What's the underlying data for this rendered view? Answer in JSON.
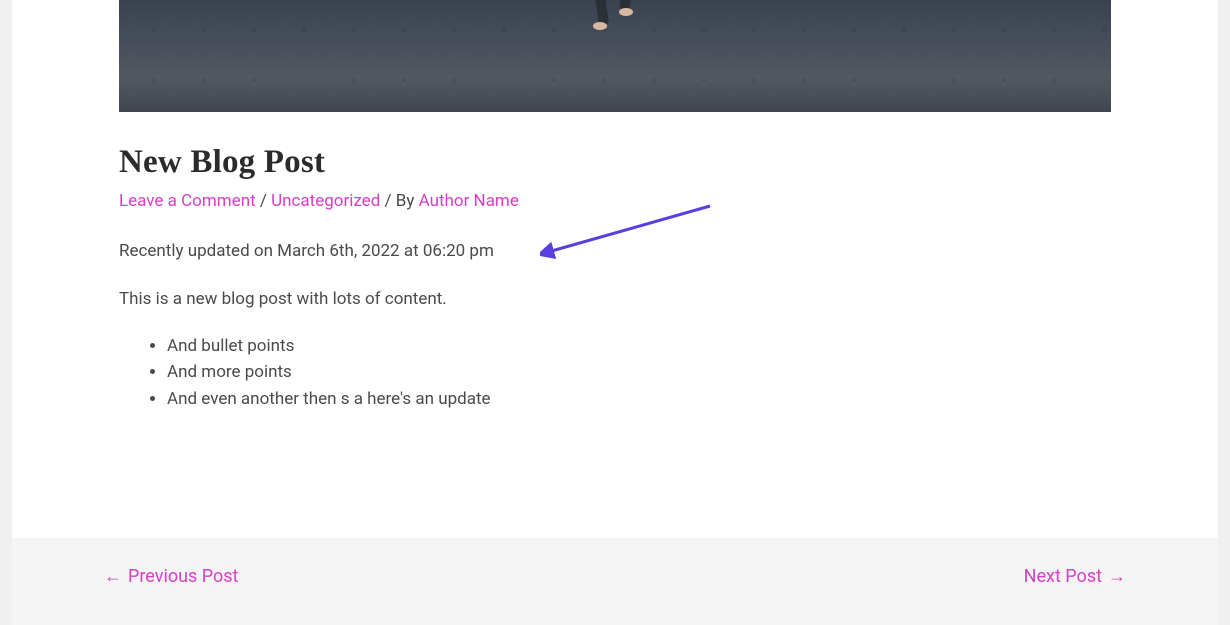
{
  "post": {
    "title": "New Blog Post",
    "meta": {
      "comment_link": "Leave a Comment",
      "sep1": " / ",
      "category": "Uncategorized",
      "by_text": " / By ",
      "author": "Author Name"
    },
    "updated_text": "Recently updated on March 6th, 2022 at 06:20 pm",
    "intro": "This is a new blog post with lots of content.",
    "bullets": [
      "And bullet points",
      "And more points",
      "And even another then s a here's an update"
    ]
  },
  "nav": {
    "prev_arrow": "←",
    "prev_label": "Previous Post",
    "next_label": "Next Post",
    "next_arrow": "→"
  }
}
